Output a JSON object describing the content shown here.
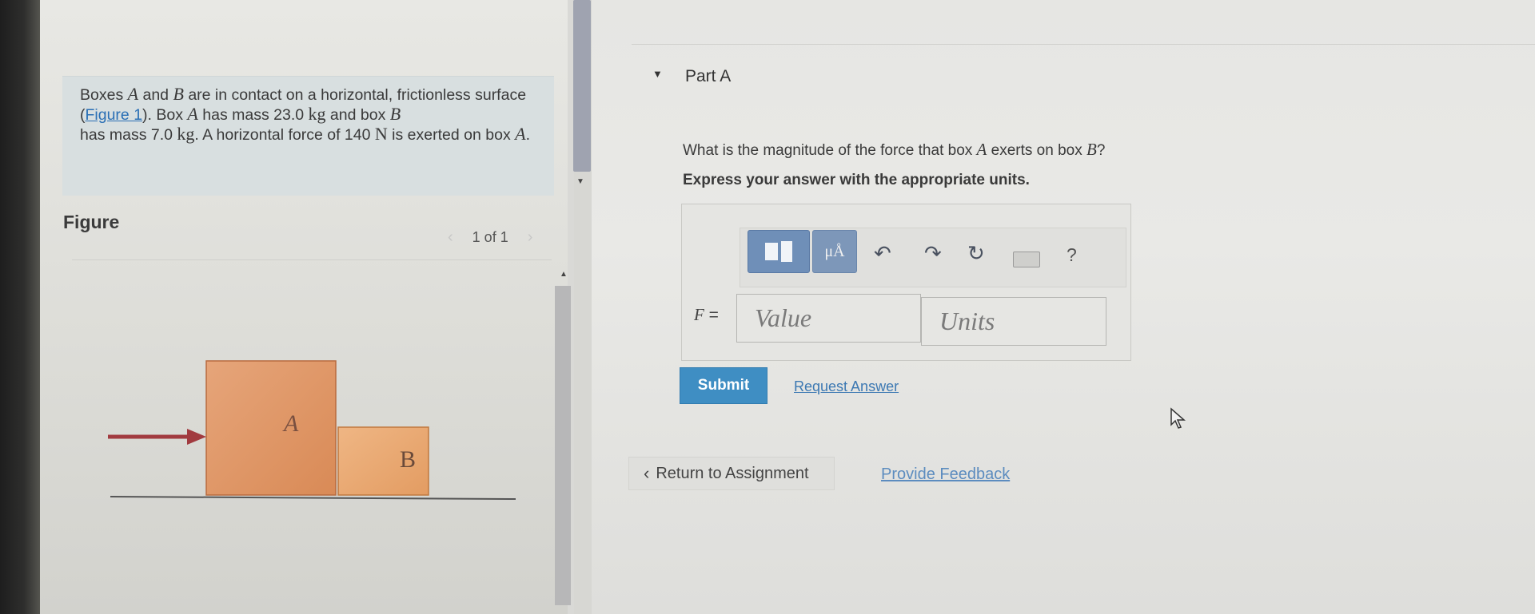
{
  "problem": {
    "p1": "Boxes ",
    "varA": "A",
    "p2": " and ",
    "varB": "B",
    "p3": " are in contact on a horizontal, frictionless surface (",
    "figure_link": "Figure 1",
    "p4": "). Box ",
    "varA2": "A",
    "p5": " has mass 23.0 ",
    "unit_kg": "kg",
    "p6": " and box ",
    "varB2": "B",
    "p7": " has mass 7.0 ",
    "unit_kg2": "kg",
    "p8": ". A horizontal force of 140 ",
    "unit_N": "N",
    "p9": " is exerted on box ",
    "varA3": "A",
    "p10": "."
  },
  "figure": {
    "title": "Figure",
    "pager": "1 of 1",
    "box_a_label": "A",
    "box_b_label": "B",
    "colors": {
      "box_a": "#e09a6b",
      "box_b": "#e8aa74",
      "arrow": "#a13a3f"
    }
  },
  "part": {
    "title": "Part A",
    "question_pre": "What is the magnitude of the force that box ",
    "question_varA": "A",
    "question_mid": " exerts on box ",
    "question_varB": "B",
    "question_post": "?",
    "instruction": "Express your answer with the appropriate units."
  },
  "toolbar": {
    "units_button": "μÅ",
    "help": "?"
  },
  "answer": {
    "label_var": "F",
    "label_eq": " =",
    "value_placeholder": "Value",
    "units_placeholder": "Units"
  },
  "actions": {
    "submit": "Submit",
    "request_answer": "Request Answer",
    "return": "Return to Assignment",
    "feedback": "Provide Feedback"
  }
}
